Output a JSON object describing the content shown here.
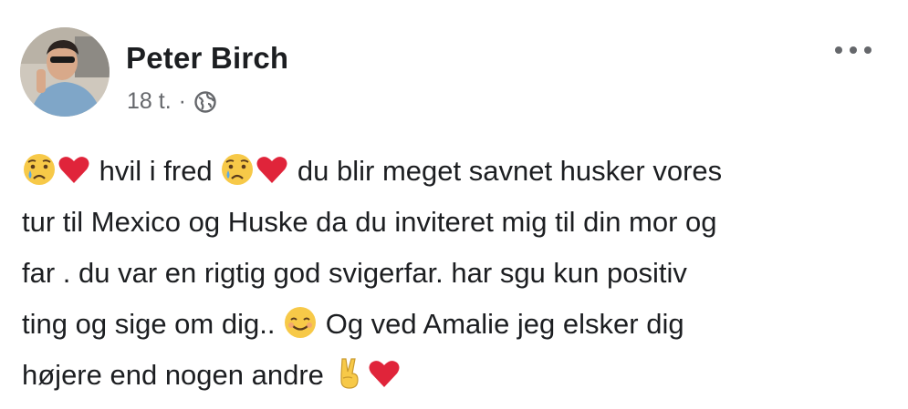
{
  "post": {
    "author": "Peter Birch",
    "timestamp": "18 t.",
    "separator": "·",
    "audience_icon": "globe-icon",
    "more_icon": "more-horizontal-icon",
    "body": {
      "line1_seg1": "hvil i fred",
      "line1_seg2": "du blir meget savnet husker vores",
      "line2": "tur til Mexico og Huske da du inviteret mig til din mor og",
      "line3": "far . du var en rigtig god svigerfar.  har sgu kun positiv",
      "line4_seg1": "ting og sige om dig..",
      "line4_seg2": "Og ved Amalie jeg elsker dig",
      "line5": "højere end nogen andre"
    },
    "emojis": [
      "crying-face-emoji",
      "red-heart-emoji",
      "smiling-face-emoji",
      "victory-hand-emoji"
    ]
  },
  "colors": {
    "text": "#1c1e21",
    "secondary": "#65676b",
    "heart": "#e0243a",
    "emoji_yellow": "#f7c948"
  }
}
